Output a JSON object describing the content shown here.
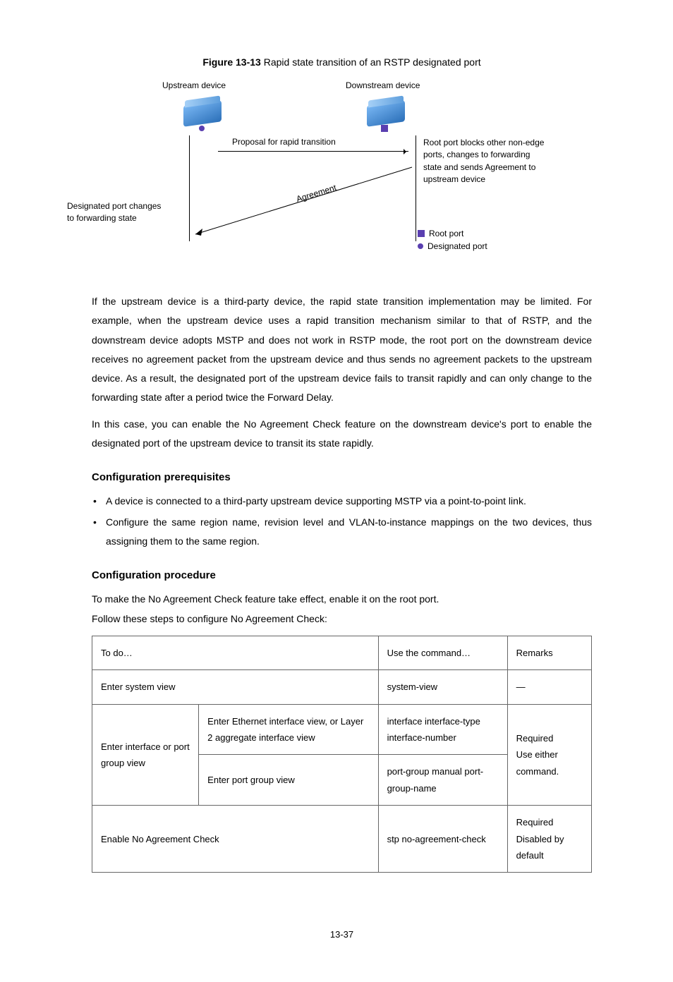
{
  "figure": {
    "number": "Figure 13-13",
    "title": "Rapid state transition of an RSTP designated port",
    "upstream_label": "Upstream device",
    "downstream_label": "Downstream device",
    "proposal_label": "Proposal for rapid transition",
    "agreement_label": "Agreement",
    "left_note": "Designated port changes to forwarding state",
    "right_note": "Root port blocks other non-edge ports, changes to forwarding state and sends Agreement to upstream device",
    "legend_root": "Root port",
    "legend_designated": "Designated port"
  },
  "paragraphs": {
    "p1": "If the upstream device is a third-party device, the rapid state transition implementation may be limited. For example, when the upstream device uses a rapid transition mechanism similar to that of RSTP, and the downstream device adopts MSTP and does not work in RSTP mode, the root port on the downstream device receives no agreement packet from the upstream device and thus sends no agreement packets to the upstream device. As a result, the designated port of the upstream device fails to transit rapidly and can only change to the forwarding state after a period twice the Forward Delay.",
    "p2": "In this case, you can enable the No Agreement Check feature on the downstream device's port to enable the designated port of the upstream device to transit its state rapidly."
  },
  "prereq_heading": "Configuration prerequisites",
  "bullets": {
    "b1": "A device is connected to a third-party upstream device supporting MSTP via a point-to-point link.",
    "b2": "Configure the same region name, revision level and VLAN-to-instance mappings on the two devices, thus assigning them to the same region."
  },
  "proc_heading": "Configuration procedure",
  "proc_intro1": "To make the No Agreement Check feature take effect, enable it on the root port.",
  "proc_intro2": "Follow these steps to configure No Agreement Check:",
  "table": {
    "h_todo": "To do…",
    "h_cmd": "Use the command…",
    "h_rem": "Remarks",
    "r1_todo": "Enter system view",
    "r1_cmd": "system-view",
    "r1_rem": "—",
    "r2_todo": "Enter interface or port group view",
    "r2a_todo": "Enter Ethernet interface view, or Layer 2 aggregate interface view",
    "r2a_cmd": "interface interface-type interface-number",
    "r2b_todo": "Enter port group view",
    "r2b_cmd": "port-group manual port-group-name",
    "r2_rem1": "Required",
    "r2_rem2": "Use either command.",
    "r3_todo": "Enable No Agreement Check",
    "r3_cmd": "stp no-agreement-check",
    "r3_rem1": "Required",
    "r3_rem2": "Disabled by default"
  },
  "page_number": "13-37"
}
